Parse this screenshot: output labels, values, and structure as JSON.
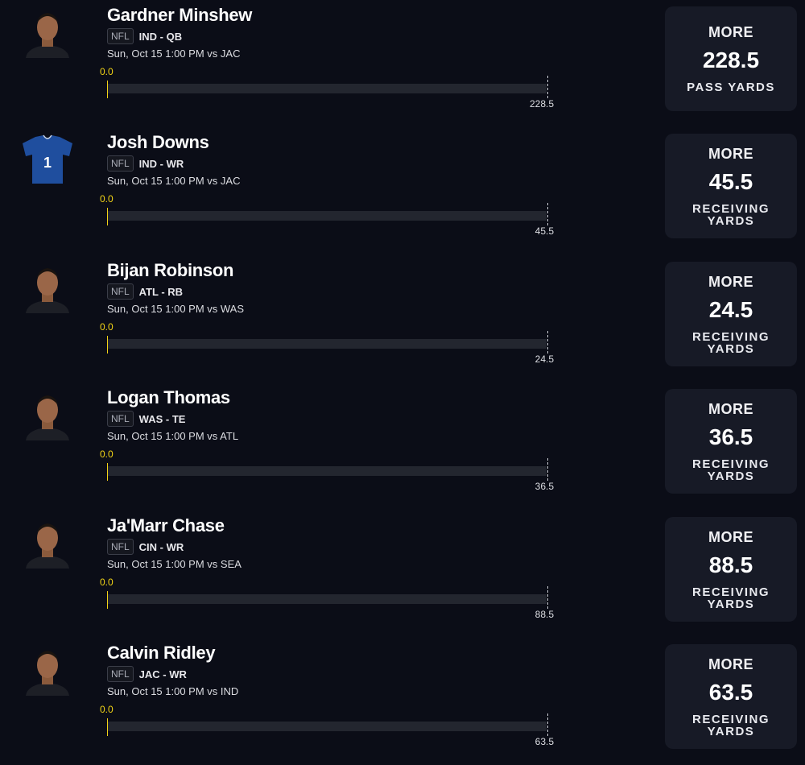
{
  "players": [
    {
      "name": "Gardner Minshew",
      "league": "NFL",
      "team_pos": "IND - QB",
      "game": "Sun, Oct 15 1:00 PM  vs JAC",
      "progress_start": "0.0",
      "progress_value": 0,
      "line": "228.5",
      "direction": "MORE",
      "stat": "PASS YARDS",
      "avatar_icon": "player-headshot-icon"
    },
    {
      "name": "Josh Downs",
      "league": "NFL",
      "team_pos": "IND - WR",
      "game": "Sun, Oct 15 1:00 PM  vs JAC",
      "progress_start": "0.0",
      "progress_value": 0,
      "line": "45.5",
      "direction": "MORE",
      "stat": "RECEIVING YARDS",
      "avatar_icon": "jersey-icon",
      "jersey_number": "1"
    },
    {
      "name": "Bijan Robinson",
      "league": "NFL",
      "team_pos": "ATL - RB",
      "game": "Sun, Oct 15 1:00 PM  vs WAS",
      "progress_start": "0.0",
      "progress_value": 0,
      "line": "24.5",
      "direction": "MORE",
      "stat": "RECEIVING YARDS",
      "avatar_icon": "player-headshot-icon"
    },
    {
      "name": "Logan Thomas",
      "league": "NFL",
      "team_pos": "WAS - TE",
      "game": "Sun, Oct 15 1:00 PM  vs ATL",
      "progress_start": "0.0",
      "progress_value": 0,
      "line": "36.5",
      "direction": "MORE",
      "stat": "RECEIVING YARDS",
      "avatar_icon": "player-headshot-icon"
    },
    {
      "name": "Ja'Marr Chase",
      "league": "NFL",
      "team_pos": "CIN - WR",
      "game": "Sun, Oct 15 1:00 PM  vs SEA",
      "progress_start": "0.0",
      "progress_value": 0,
      "line": "88.5",
      "direction": "MORE",
      "stat": "RECEIVING YARDS",
      "avatar_icon": "player-headshot-icon"
    },
    {
      "name": "Calvin Ridley",
      "league": "NFL",
      "team_pos": "JAC - WR",
      "game": "Sun, Oct 15 1:00 PM  vs IND",
      "progress_start": "0.0",
      "progress_value": 0,
      "line": "63.5",
      "direction": "MORE",
      "stat": "RECEIVING YARDS",
      "avatar_icon": "player-headshot-icon"
    }
  ],
  "colors": {
    "background": "#0b0d17",
    "card": "#171a26",
    "progress_accent": "#f2d416",
    "track": "#23262f",
    "jersey_blue": "#1f4e9e"
  }
}
